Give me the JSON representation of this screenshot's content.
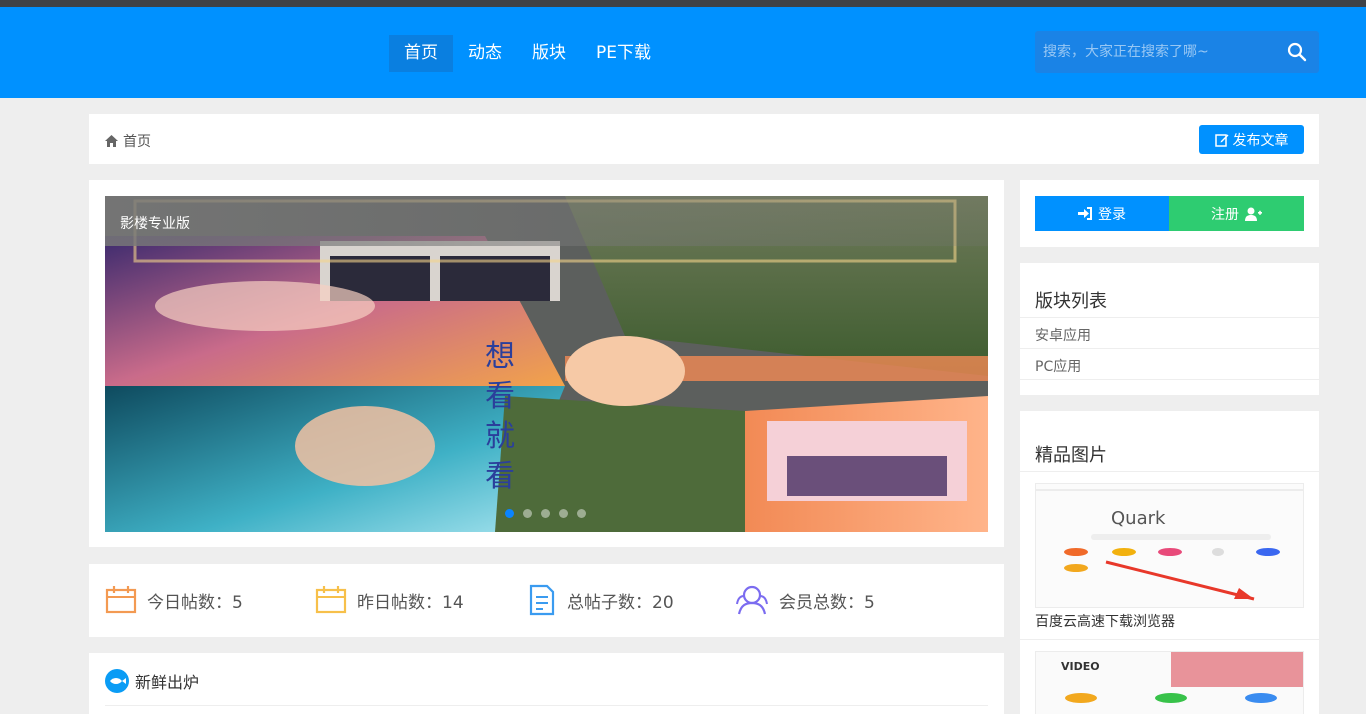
{
  "nav": {
    "items": [
      "首页",
      "动态",
      "版块",
      "PE下载"
    ],
    "active": 0
  },
  "search": {
    "placeholder": "搜索，大家正在搜索了哪~"
  },
  "breadcrumb": {
    "home": "首页"
  },
  "post_button": "发布文章",
  "slider": {
    "caption": "影楼专业版",
    "dots": 5,
    "active_dot": 0
  },
  "stats": [
    {
      "label": "今日帖数：",
      "value": "5",
      "icon": "calendar-icon",
      "color": "#f39a52"
    },
    {
      "label": "昨日帖数：",
      "value": "14",
      "icon": "calendar-icon",
      "color": "#f7c04a"
    },
    {
      "label": "总帖子数：",
      "value": "20",
      "icon": "document-icon",
      "color": "#3a9bf0"
    },
    {
      "label": "会员总数：",
      "value": "5",
      "icon": "members-icon",
      "color": "#7b6cf0"
    }
  ],
  "fresh": {
    "title": "新鲜出炉"
  },
  "auth": {
    "login": "登录",
    "register": "注册"
  },
  "boards": {
    "title": "版块列表",
    "items": [
      "安卓应用",
      "PC应用"
    ]
  },
  "gallery": {
    "title": "精品图片",
    "items": [
      {
        "caption": "百度云高速下载浏览器"
      }
    ]
  },
  "colors": {
    "primary": "#0091ff",
    "success": "#2ecc71",
    "topbar": "#3f4247"
  }
}
